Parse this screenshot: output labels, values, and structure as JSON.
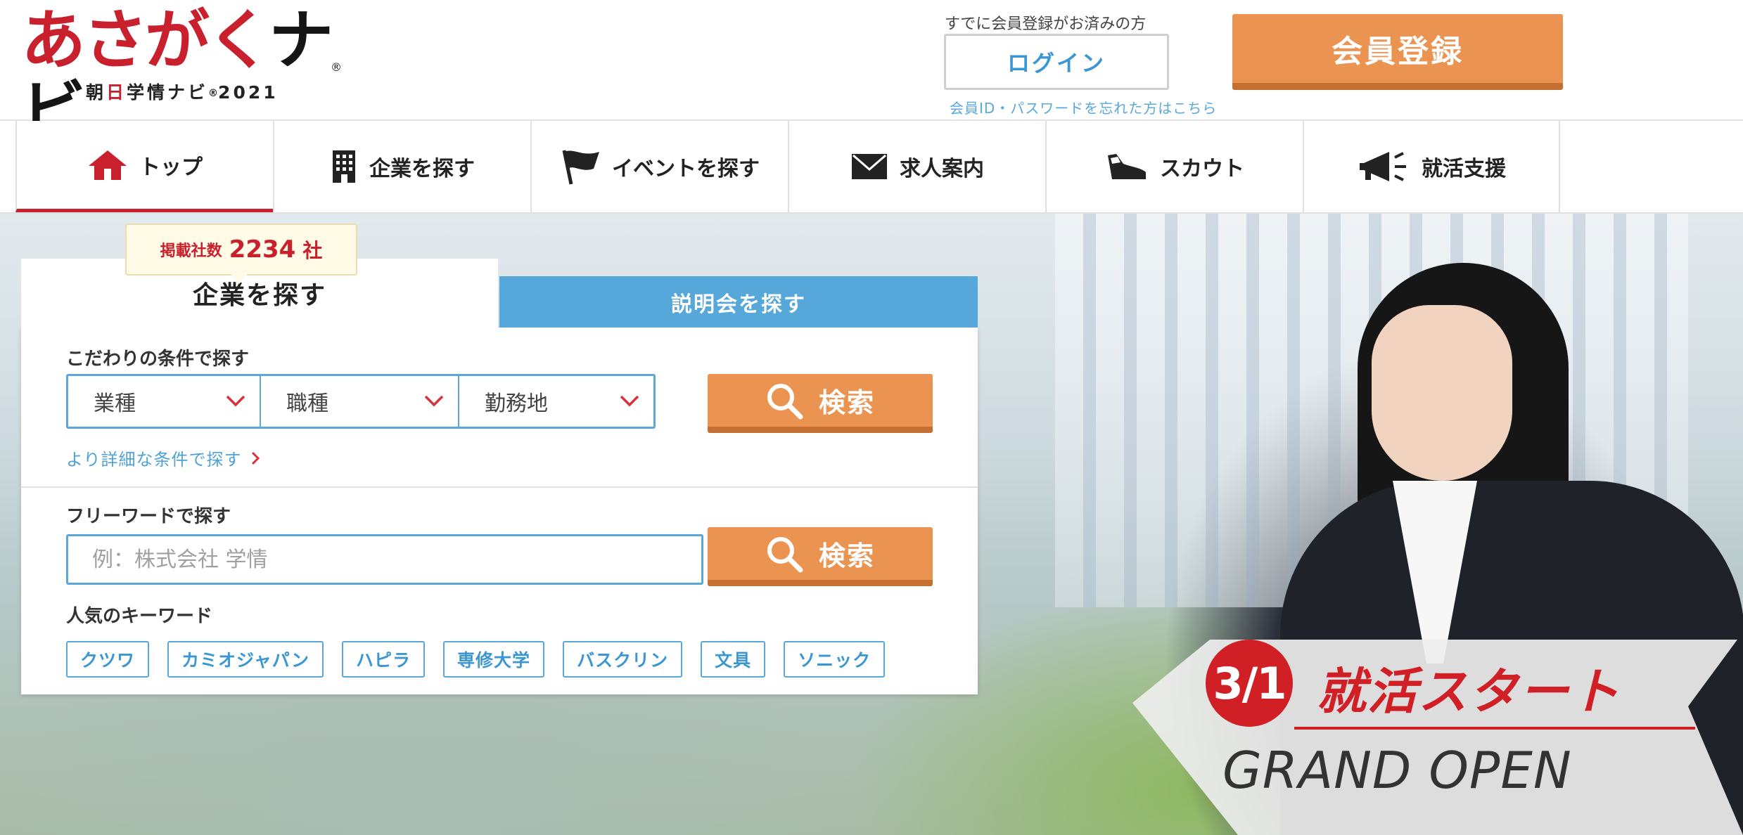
{
  "header": {
    "logo_main_a": "あさが",
    "logo_main_b": "く",
    "logo_main_c": "ナビ",
    "logo_reg": "®",
    "logo_sub_a": "朝",
    "logo_sub_b": "日",
    "logo_sub_c": "学情ナビ",
    "logo_sub_d": "®",
    "logo_sub_e": "2021",
    "already_member": "すでに会員登録がお済みの方",
    "login_label": "ログイン",
    "forgot_link": "会員ID・パスワードを忘れた方はこちら",
    "register_label": "会員登録"
  },
  "nav": {
    "items": [
      {
        "label": "トップ",
        "icon": "home-icon"
      },
      {
        "label": "企業を探す",
        "icon": "building-icon"
      },
      {
        "label": "イベントを探す",
        "icon": "flag-icon"
      },
      {
        "label": "求人案内",
        "icon": "envelope-icon"
      },
      {
        "label": "スカウト",
        "icon": "shoe-icon"
      },
      {
        "label": "就活支援",
        "icon": "megaphone-icon"
      }
    ],
    "active_index": 0
  },
  "search": {
    "count_label": "掲載社数",
    "count_value": "2234",
    "count_unit": "社",
    "tab_company": "企業を探す",
    "tab_seminar": "説明会を探す",
    "condition_label": "こだわりの条件で探す",
    "select_industry": "業種",
    "select_job": "職種",
    "select_location": "勤務地",
    "search_button": "検索",
    "detail_link": "より詳細な条件で探す",
    "freeword_label": "フリーワードで探す",
    "freeword_placeholder": "例：株式会社 学情",
    "popular_label": "人気のキーワード",
    "keywords": [
      "クツワ",
      "カミオジャパン",
      "ハピラ",
      "専修大学",
      "バスクリン",
      "文具",
      "ソニック"
    ]
  },
  "banner": {
    "date": "3/1",
    "title": "就活スタート",
    "subtitle": "GRAND OPEN"
  },
  "colors": {
    "brand_red": "#c8202c",
    "accent_blue": "#56a7da",
    "button_orange": "#eb9351"
  }
}
